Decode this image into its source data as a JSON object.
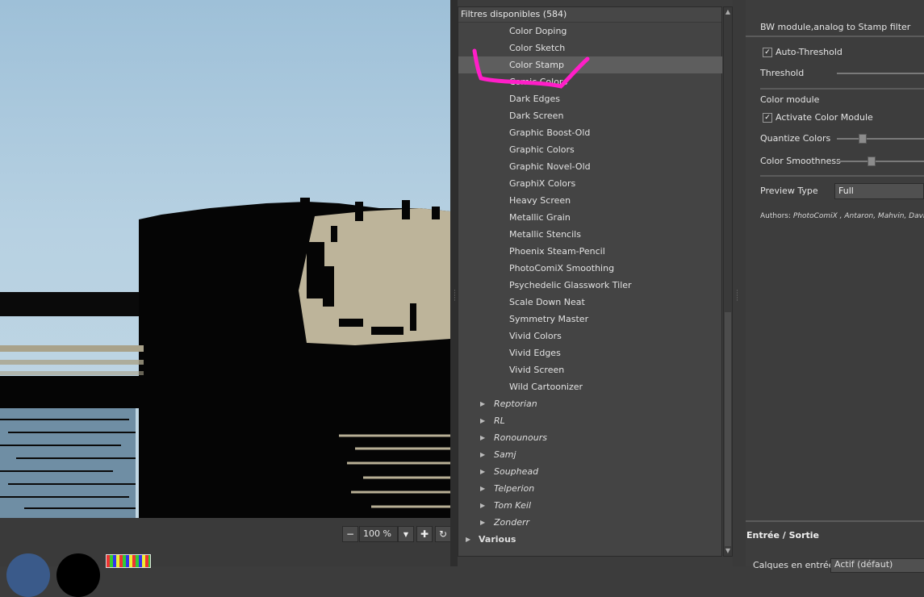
{
  "preview": {
    "zoom": "100 %",
    "zoom_out_icon": "minus-icon",
    "dropdown_icon": "triangle-down-icon",
    "zoom_in_icon": "plus-icon",
    "refresh_icon": "refresh-icon"
  },
  "filters": {
    "header": "Filtres disponibles (584)",
    "items": [
      {
        "label": "Color Doping"
      },
      {
        "label": "Color Sketch"
      },
      {
        "label": "Color Stamp",
        "selected": true
      },
      {
        "label": "Comic Colors"
      },
      {
        "label": "Dark Edges"
      },
      {
        "label": "Dark Screen"
      },
      {
        "label": "Graphic Boost-Old"
      },
      {
        "label": "Graphic Colors"
      },
      {
        "label": "Graphic Novel-Old"
      },
      {
        "label": "GraphiX Colors"
      },
      {
        "label": "Heavy Screen"
      },
      {
        "label": "Metallic Grain"
      },
      {
        "label": "Metallic Stencils"
      },
      {
        "label": "Phoenix Steam-Pencil"
      },
      {
        "label": "PhotoComiX Smoothing"
      },
      {
        "label": "Psychedelic Glasswork Tiler"
      },
      {
        "label": "Scale Down Neat"
      },
      {
        "label": "Symmetry Master"
      },
      {
        "label": "Vivid Colors"
      },
      {
        "label": "Vivid Edges"
      },
      {
        "label": "Vivid Screen"
      },
      {
        "label": "Wild Cartoonizer"
      }
    ],
    "groups": [
      {
        "label": "Reptorian"
      },
      {
        "label": "RL"
      },
      {
        "label": "Ronounours"
      },
      {
        "label": "Samj"
      },
      {
        "label": "Souphead"
      },
      {
        "label": "Telperion"
      },
      {
        "label": "Tom Keil"
      },
      {
        "label": "Zonderr"
      }
    ],
    "top_group": {
      "label": "Various"
    },
    "annotation_color": "#ff1ec8"
  },
  "settings": {
    "description": "BW module,analog to Stamp filter",
    "auto_threshold": {
      "label": "Auto-Threshold",
      "checked": true
    },
    "threshold": {
      "label": "Threshold"
    },
    "color_module": "Color module",
    "activate_color": {
      "label": "Activate Color Module",
      "checked": true
    },
    "quantize": {
      "label": "Quantize Colors"
    },
    "smoothness": {
      "label": "Color Smoothness"
    },
    "preview_type": {
      "label": "Preview Type",
      "value": "Full"
    },
    "authors_label": "Authors:",
    "authors": "PhotoComiX , Antaron, Mahvin, David",
    "io_title": "Entrée / Sortie",
    "input_layers_label": "Calques en entrée",
    "input_layers_value": "Actif (défaut)"
  }
}
